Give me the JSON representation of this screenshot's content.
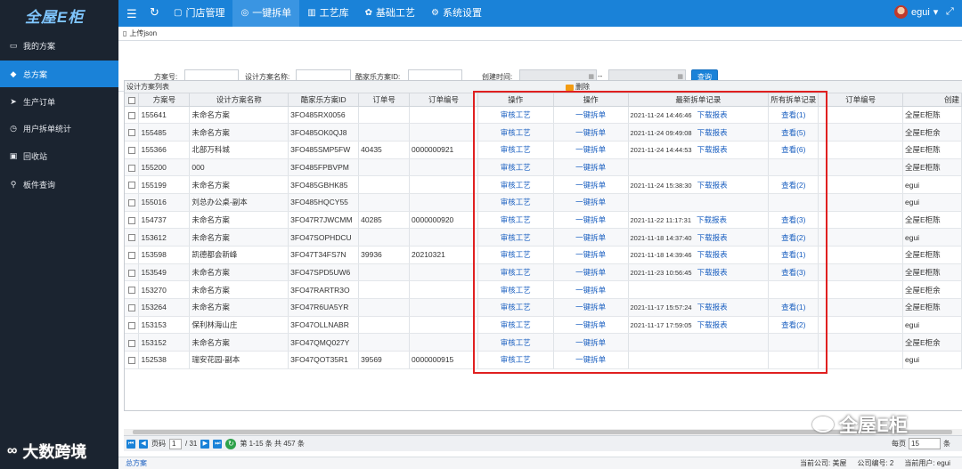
{
  "app": {
    "logo": "全屋E柜"
  },
  "topnav": {
    "items": [
      {
        "label": "门店管理",
        "icon": "document-icon"
      },
      {
        "label": "一键拆单",
        "icon": "check-circle-icon",
        "active": true
      },
      {
        "label": "工艺库",
        "icon": "chart-icon"
      },
      {
        "label": "基础工艺",
        "icon": "palette-icon"
      },
      {
        "label": "系统设置",
        "icon": "gear-icon"
      }
    ],
    "user": "egui"
  },
  "sidebar": {
    "items": [
      {
        "label": "我的方案",
        "icon": "monitor-icon"
      },
      {
        "label": "总方案",
        "icon": "diamond-icon",
        "active": true
      },
      {
        "label": "生产订单",
        "icon": "send-icon"
      },
      {
        "label": "用户拆单统计",
        "icon": "clock-icon"
      },
      {
        "label": "回收站",
        "icon": "trash-icon"
      },
      {
        "label": "板件查询",
        "icon": "search-icon"
      }
    ]
  },
  "toolbar": {
    "upload_json": "上传json"
  },
  "filters": {
    "plan_no_label": "方案号:",
    "plan_name_label": "设计方案名称:",
    "kujiale_id_label": "酷家乐方案ID:",
    "created_label": "创建时间:",
    "separator": "--",
    "search_button": "查询"
  },
  "grid": {
    "title": "设计方案列表",
    "delete_label": "删除",
    "columns": [
      "方案号",
      "设计方案名称",
      "酷家乐方案ID",
      "订单号",
      "订单编号",
      "操作",
      "操作",
      "最新拆单记录",
      "所有拆单记录",
      "订单编号",
      "创建"
    ],
    "audit_label": "审核工艺",
    "split_label": "一键拆单",
    "report_label": "下载报表",
    "rows": [
      {
        "id": "155641",
        "name": "未命名方案",
        "kid": "3FO485RX0056",
        "order_no": "",
        "order_code": "",
        "latest": "2021-11-24 14:46:46",
        "all": "查看(1)",
        "creator": "全屋E柜陈"
      },
      {
        "id": "155485",
        "name": "未命名方案",
        "kid": "3FO485OK0QJ8",
        "order_no": "",
        "order_code": "",
        "latest": "2021-11-24 09:49:08",
        "all": "查看(5)",
        "creator": "全屋E柜余"
      },
      {
        "id": "155366",
        "name": "北部万科城",
        "kid": "3FO485SMP5FW",
        "order_no": "40435",
        "order_code": "0000000921",
        "latest": "2021-11-24 14:44:53",
        "all": "查看(6)",
        "creator": "全屋E柜陈"
      },
      {
        "id": "155200",
        "name": "000",
        "kid": "3FO485FPBVPM",
        "order_no": "",
        "order_code": "",
        "latest": "",
        "all": "",
        "creator": "全屋E柜陈"
      },
      {
        "id": "155199",
        "name": "未命名方案",
        "kid": "3FO485GBHK85",
        "order_no": "",
        "order_code": "",
        "latest": "2021-11-24 15:38:30",
        "all": "查看(2)",
        "creator": "egui"
      },
      {
        "id": "155016",
        "name": "刘总办公桌-副本",
        "kid": "3FO485HQCY55",
        "order_no": "",
        "order_code": "",
        "latest": "",
        "all": "",
        "creator": "egui"
      },
      {
        "id": "154737",
        "name": "未命名方案",
        "kid": "3FO47R7JWCMM",
        "order_no": "40285",
        "order_code": "0000000920",
        "latest": "2021-11-22 11:17:31",
        "all": "查看(3)",
        "creator": "全屋E柜陈"
      },
      {
        "id": "153612",
        "name": "未命名方案",
        "kid": "3FO47SOPHDCU",
        "order_no": "",
        "order_code": "",
        "latest": "2021-11-18 14:37:40",
        "all": "查看(2)",
        "creator": "egui"
      },
      {
        "id": "153598",
        "name": "凯德都会新峰",
        "kid": "3FO47T34FS7N",
        "order_no": "39936",
        "order_code": "20210321",
        "latest": "2021-11-18 14:39:46",
        "all": "查看(1)",
        "creator": "全屋E柜陈"
      },
      {
        "id": "153549",
        "name": "未命名方案",
        "kid": "3FO47SPD5UW6",
        "order_no": "",
        "order_code": "",
        "latest": "2021-11-23 10:56:45",
        "all": "查看(3)",
        "creator": "全屋E柜陈"
      },
      {
        "id": "153270",
        "name": "未命名方案",
        "kid": "3FO47RARTR3O",
        "order_no": "",
        "order_code": "",
        "latest": "",
        "all": "",
        "creator": "全屋E柜余"
      },
      {
        "id": "153264",
        "name": "未命名方案",
        "kid": "3FO47R6UA5YR",
        "order_no": "",
        "order_code": "",
        "latest": "2021-11-17 15:57:24",
        "all": "查看(1)",
        "creator": "全屋E柜陈"
      },
      {
        "id": "153153",
        "name": "保利林海山庄",
        "kid": "3FO47OLLNABR",
        "order_no": "",
        "order_code": "",
        "latest": "2021-11-17 17:59:05",
        "all": "查看(2)",
        "creator": "egui"
      },
      {
        "id": "153152",
        "name": "未命名方案",
        "kid": "3FO47QMQ027Y",
        "order_no": "",
        "order_code": "",
        "latest": "",
        "all": "",
        "creator": "全屋E柜余"
      },
      {
        "id": "152538",
        "name": "瑞安花园-副本",
        "kid": "3FO47QOT35R1",
        "order_no": "39569",
        "order_code": "0000000915",
        "latest": "",
        "all": "",
        "creator": "egui"
      }
    ]
  },
  "pager": {
    "page_label": "页码",
    "page": "1",
    "total_pages": "/ 31",
    "summary": "第 1-15 条  共 457 条",
    "per_page_label": "每页",
    "per_page": "15",
    "per_page_suffix": "条"
  },
  "status": {
    "breadcrumb": "总方案",
    "company": "当前公司: 美屋",
    "company_no": "公司编号: 2",
    "user": "当前用户: egui"
  },
  "watermarks": {
    "left": "大数跨境",
    "right": "全屋E柜"
  }
}
